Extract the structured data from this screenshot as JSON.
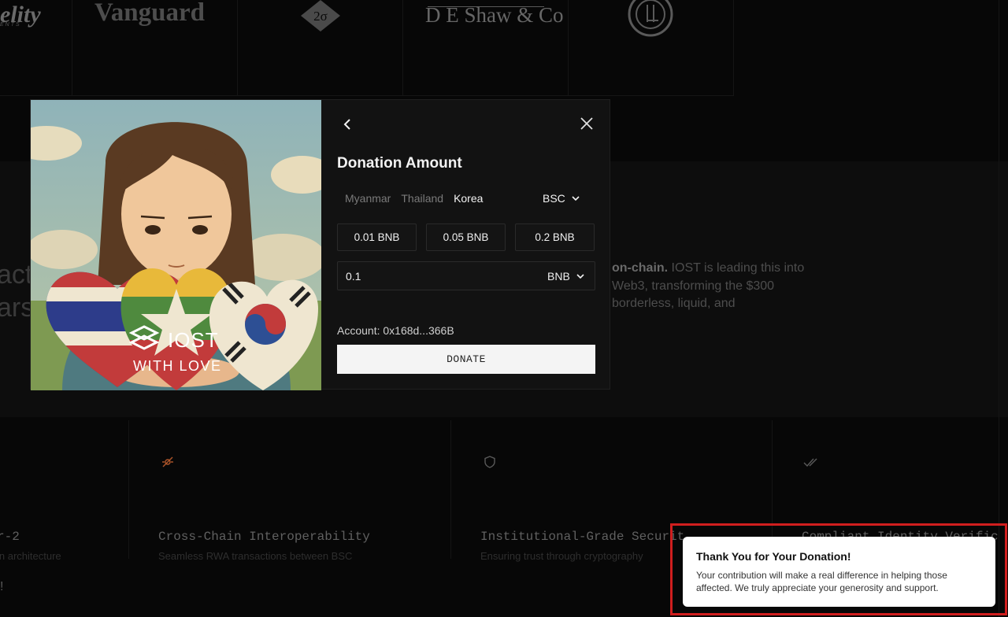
{
  "logos": {
    "fidelity": "elity",
    "fidelity_sub": "ENTS",
    "vanguard": "Vanguard",
    "two_sigma": "2σ",
    "deshaw": "D E Shaw & Co"
  },
  "hero": {
    "left_line_1": "act",
    "left_line_2": "ars",
    "para_bold": "on-chain.",
    "para_rest": " IOST is leading this into Web3, transforming the $300 borderless, liquid, and"
  },
  "features": [
    {
      "title": "r-2",
      "sub": "in architecture",
      "icon": "none"
    },
    {
      "title": "Cross-Chain Interoperability",
      "sub": "Seamless RWA transactions between BSC",
      "icon": "link-icon"
    },
    {
      "title": "Institutional-Grade Securit",
      "sub": "Ensuring trust through cryptography",
      "icon": "shield-icon"
    },
    {
      "title": "Compliant Identity Verific",
      "sub": "",
      "icon": "double-check-icon"
    }
  ],
  "bottom_exclaim": "!",
  "modal": {
    "image_brand": "IOST",
    "image_tagline": "WITH LOVE",
    "title": "Donation Amount",
    "countries": [
      "Myanmar",
      "Thailand",
      "Korea"
    ],
    "active_country": "Korea",
    "chain": "BSC",
    "preset_amounts": [
      "0.01 BNB",
      "0.05 BNB",
      "0.2 BNB"
    ],
    "amount_value": "0.1",
    "token": "BNB",
    "account": "Account: 0x168d...366B",
    "donate_label": "DONATE"
  },
  "toast": {
    "title": "Thank You for Your Donation!",
    "body": "Your contribution will make a real difference in helping those affected. We truly appreciate your generosity and support."
  },
  "colors": {
    "background": "#070707",
    "modal": "#121212",
    "highlight": "#d01e1e",
    "toast": "#ffffff"
  }
}
